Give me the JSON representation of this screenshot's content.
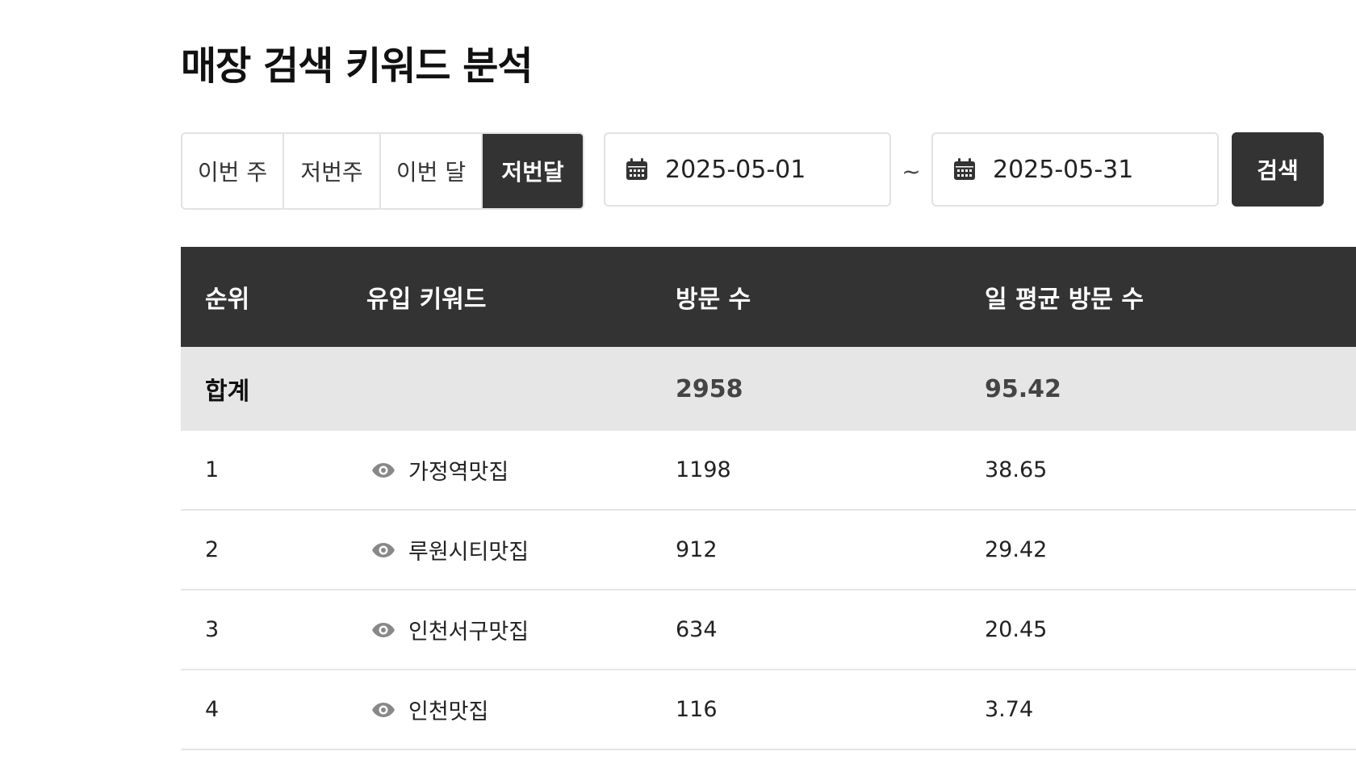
{
  "page": {
    "title": "매장 검색 키워드 분석"
  },
  "filters": {
    "periods": [
      {
        "label": "이번 주",
        "active": false
      },
      {
        "label": "저번주",
        "active": false
      },
      {
        "label": "이번 달",
        "active": false
      },
      {
        "label": "저번달",
        "active": true
      }
    ],
    "start_date": "2025-05-01",
    "separator": "~",
    "end_date": "2025-05-31",
    "search_label": "검색"
  },
  "table": {
    "headers": {
      "rank": "순위",
      "keyword": "유입 키워드",
      "visits": "방문 수",
      "daily_avg": "일 평균 방문 수"
    },
    "total": {
      "label": "합계",
      "visits": "2958",
      "daily_avg": "95.42"
    },
    "rows": [
      {
        "rank": "1",
        "keyword": "가정역맛집",
        "visits": "1198",
        "daily_avg": "38.65"
      },
      {
        "rank": "2",
        "keyword": "루원시티맛집",
        "visits": "912",
        "daily_avg": "29.42"
      },
      {
        "rank": "3",
        "keyword": "인천서구맛집",
        "visits": "634",
        "daily_avg": "20.45"
      },
      {
        "rank": "4",
        "keyword": "인천맛집",
        "visits": "116",
        "daily_avg": "3.74"
      }
    ]
  },
  "colors": {
    "dark": "#333333",
    "total_bg": "#e6e6e6",
    "border": "#e2e2e2",
    "icon": "#888888"
  },
  "icons": {
    "date": "calendar-icon",
    "keyword": "eye-icon"
  }
}
